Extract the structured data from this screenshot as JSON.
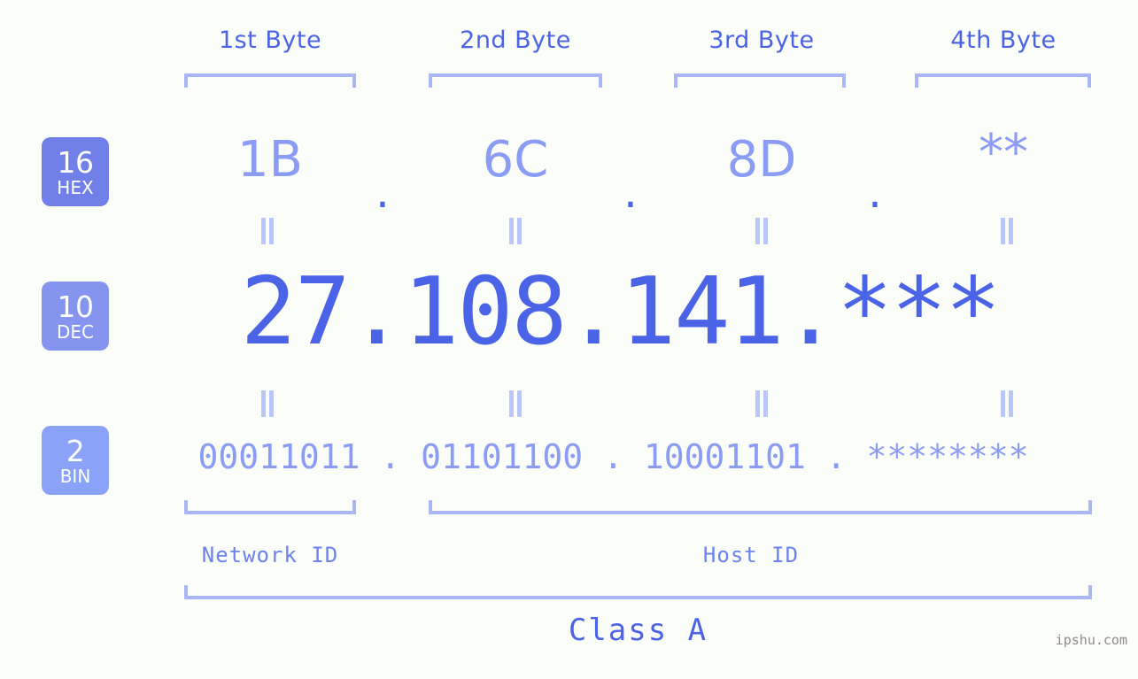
{
  "meta": {
    "background_color": "#fbfdf8",
    "accent_strong": "#4a63e7",
    "accent_mid": "#8a9cf3",
    "accent_light": "#aab7f7",
    "watermark": "ipshu.com"
  },
  "byte_headers": [
    {
      "label": "1st Byte"
    },
    {
      "label": "2nd Byte"
    },
    {
      "label": "3rd Byte"
    },
    {
      "label": "4th Byte"
    }
  ],
  "bases": [
    {
      "number": "16",
      "abbr": "HEX",
      "color": "#7180e8"
    },
    {
      "number": "10",
      "abbr": "DEC",
      "color": "#8494ef"
    },
    {
      "number": "2",
      "abbr": "BIN",
      "color": "#8aa2f8"
    }
  ],
  "rows": {
    "hex": {
      "values": [
        "1B",
        "6C",
        "8D",
        "**"
      ],
      "separator": "."
    },
    "dec": {
      "values": [
        "27",
        "108",
        "141",
        "***"
      ],
      "separator": ".",
      "text": "27.108.141.***"
    },
    "bin": {
      "values": [
        "00011011",
        "01101100",
        "10001101",
        "********"
      ],
      "separator": ".",
      "text": "00011011 . 01101100 . 10001101 . ********"
    }
  },
  "equals_symbol": "=",
  "segments": {
    "network_id": "Network ID",
    "host_id": "Host ID",
    "class": "Class A"
  }
}
